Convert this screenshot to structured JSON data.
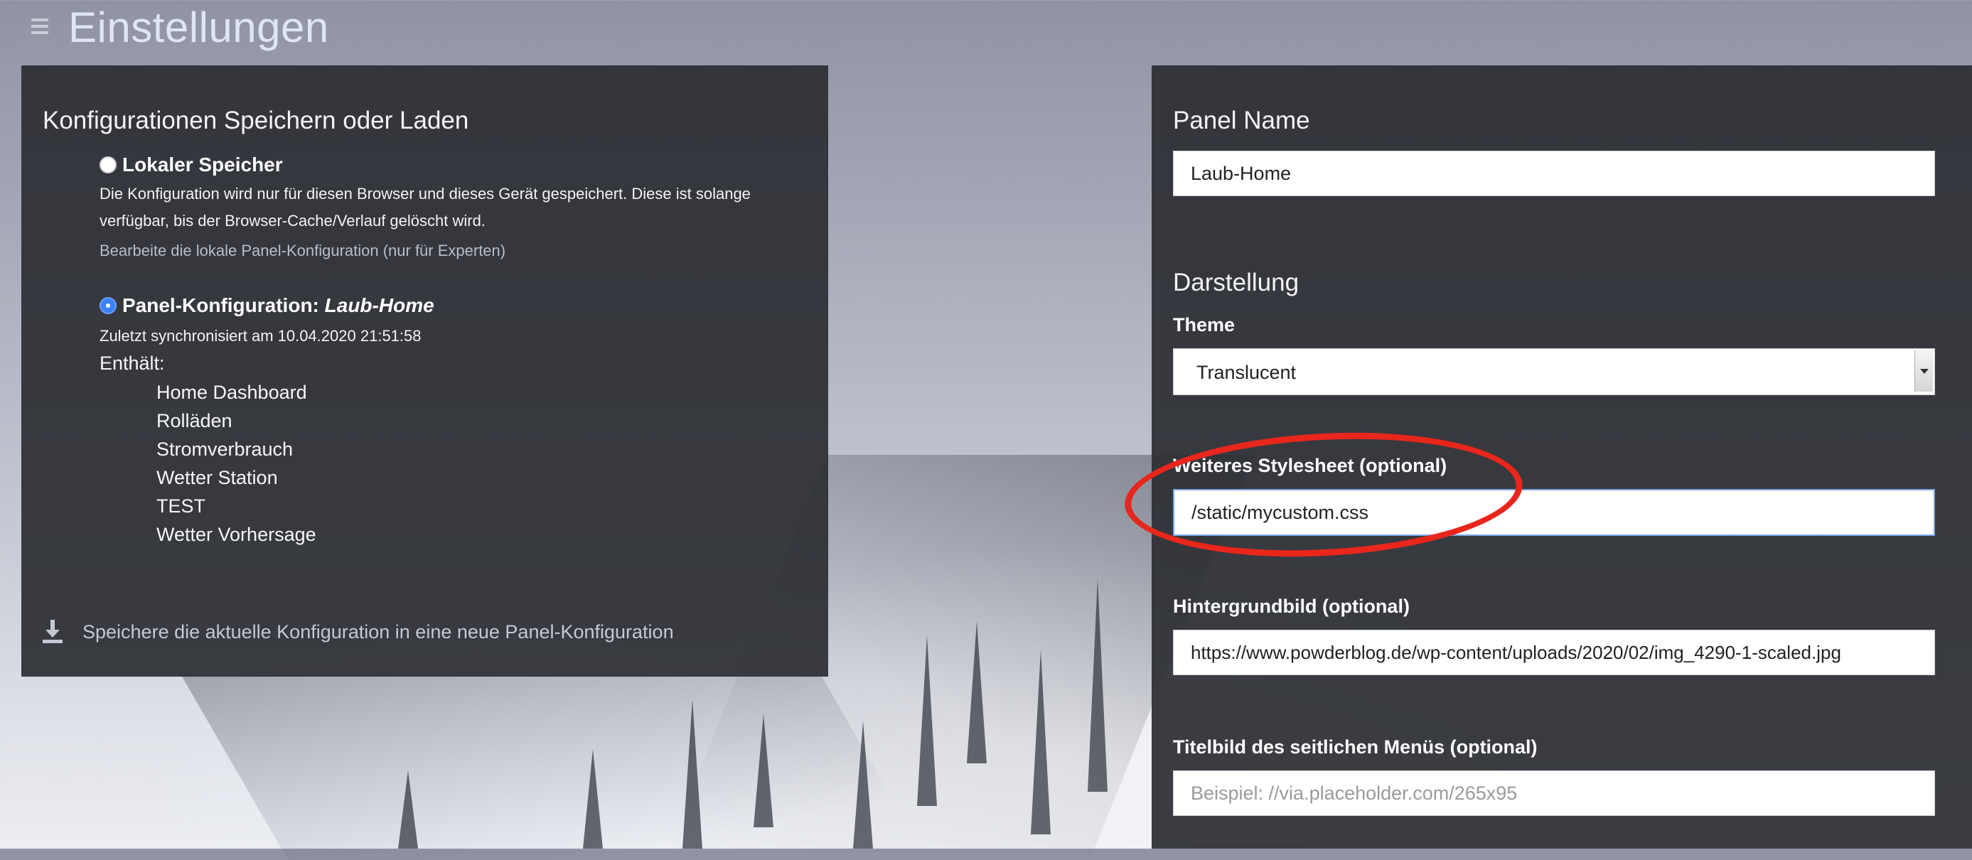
{
  "header": {
    "title": "Einstellungen",
    "menu_icon": "hamburger-menu-icon"
  },
  "left_panel": {
    "title": "Konfigurationen Speichern oder Laden",
    "local_storage": {
      "label": "Lokaler Speicher",
      "selected": false,
      "description_line1": "Die Konfiguration wird nur für diesen Browser und dieses Gerät gespeichert. Diese ist solange",
      "description_line2": "verfügbar, bis der Browser-Cache/Verlauf gelöscht wird.",
      "edit_link": "Bearbeite die lokale Panel-Konfiguration (nur für Experten)"
    },
    "panel_config": {
      "label_prefix": "Panel-Konfiguration: ",
      "label_name": "Laub-Home",
      "selected": true,
      "synced": "Zuletzt synchronisiert am 10.04.2020 21:51:58",
      "contains_label": "Enthält:",
      "dashboards": [
        "Home Dashboard",
        "Rolläden",
        "Stromverbrauch",
        "Wetter Station",
        "TEST",
        "Wetter Vorhersage"
      ]
    },
    "save_action": {
      "icon": "download-icon",
      "label": "Speichere die aktuelle Konfiguration in eine neue Panel-Konfiguration"
    }
  },
  "right_panel": {
    "panel_name": {
      "title": "Panel Name",
      "value": "Laub-Home"
    },
    "appearance": {
      "title": "Darstellung",
      "theme_label": "Theme",
      "theme_value": "Translucent",
      "stylesheet_label": "Weiteres Stylesheet (optional)",
      "stylesheet_value": "/static/mycustom.css",
      "background_label": "Hintergrundbild (optional)",
      "background_value": "https://www.powderblog.de/wp-content/uploads/2020/02/img_4290-1-scaled.jpg",
      "sidebar_image_label": "Titelbild des seitlichen Menüs (optional)",
      "sidebar_image_placeholder": "Beispiel: //via.placeholder.com/265x95"
    }
  },
  "colors": {
    "panel_bg": "#2c2e34",
    "accent_blue": "#3b82f6",
    "annotation_red": "#e8261c"
  }
}
